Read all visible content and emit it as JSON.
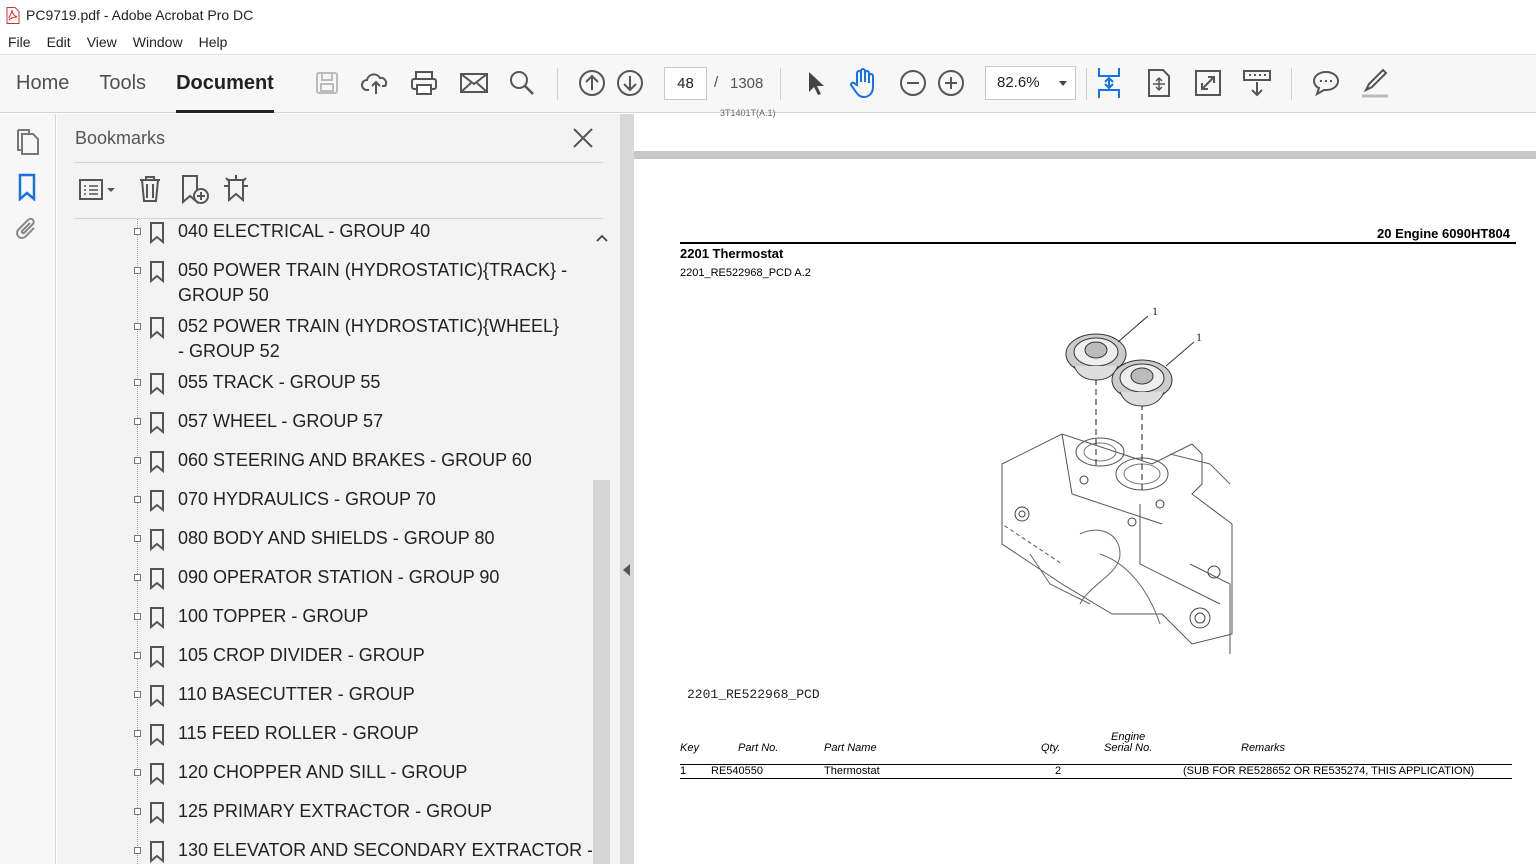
{
  "window": {
    "title": "PC9719.pdf - Adobe Acrobat Pro DC"
  },
  "menu": [
    "File",
    "Edit",
    "View",
    "Window",
    "Help"
  ],
  "nav_tabs": [
    "Home",
    "Tools",
    "Document"
  ],
  "toolbar": {
    "page_current": "48",
    "page_separator": "/",
    "page_total": "1308",
    "zoom": "82.6%",
    "icons": [
      "save-icon",
      "upload-cloud-icon",
      "print-icon",
      "email-icon",
      "search-icon",
      "arrow-up-icon",
      "arrow-down-icon",
      "select-pointer-icon",
      "hand-tool-icon",
      "zoom-out-icon",
      "zoom-in-icon",
      "fit-page-icon",
      "rotate-icon",
      "fullscreen-icon",
      "read-mode-icon",
      "comment-icon",
      "sign-icon"
    ]
  },
  "bookmarks": {
    "title": "Bookmarks",
    "items": [
      "040 ELECTRICAL - GROUP 40",
      "050 POWER TRAIN (HYDROSTATIC){TRACK} - GROUP 50",
      "052 POWER TRAIN (HYDROSTATIC){WHEEL} - GROUP 52",
      "055 TRACK - GROUP 55",
      "057 WHEEL - GROUP 57",
      "060 STEERING AND BRAKES - GROUP 60",
      "070 HYDRAULICS - GROUP 70",
      "080 BODY AND SHIELDS - GROUP 80",
      "090 OPERATOR STATION - GROUP 90",
      "100 TOPPER - GROUP",
      "105 CROP DIVIDER - GROUP",
      "110 BASECUTTER - GROUP",
      "115 FEED ROLLER - GROUP",
      "120 CHOPPER AND SILL - GROUP",
      "125 PRIMARY EXTRACTOR - GROUP",
      "130 ELEVATOR AND SECONDARY EXTRACTOR -"
    ]
  },
  "document": {
    "prev_page_tail": "3T1401T(A.1)",
    "header_right": "20  Engine  6090HT804",
    "section_title": "2201 Thermostat",
    "section_sub": "2201_RE522968_PCD A.2",
    "callouts": [
      "1",
      "1"
    ],
    "figure_label": "2201_RE522968_PCD",
    "table": {
      "headers": {
        "key": "Key",
        "part_no": "Part No.",
        "part_name": "Part Name",
        "qty": "Qty.",
        "serial_line1": "Engine",
        "serial_line2": "Serial No.",
        "remarks": "Remarks"
      },
      "rows": [
        {
          "key": "1",
          "part_no": "RE540550",
          "part_name": "Thermostat",
          "qty": "2",
          "serial": "",
          "remarks": "(SUB FOR RE528652 OR RE535274, THIS APPLICATION)"
        }
      ]
    }
  }
}
